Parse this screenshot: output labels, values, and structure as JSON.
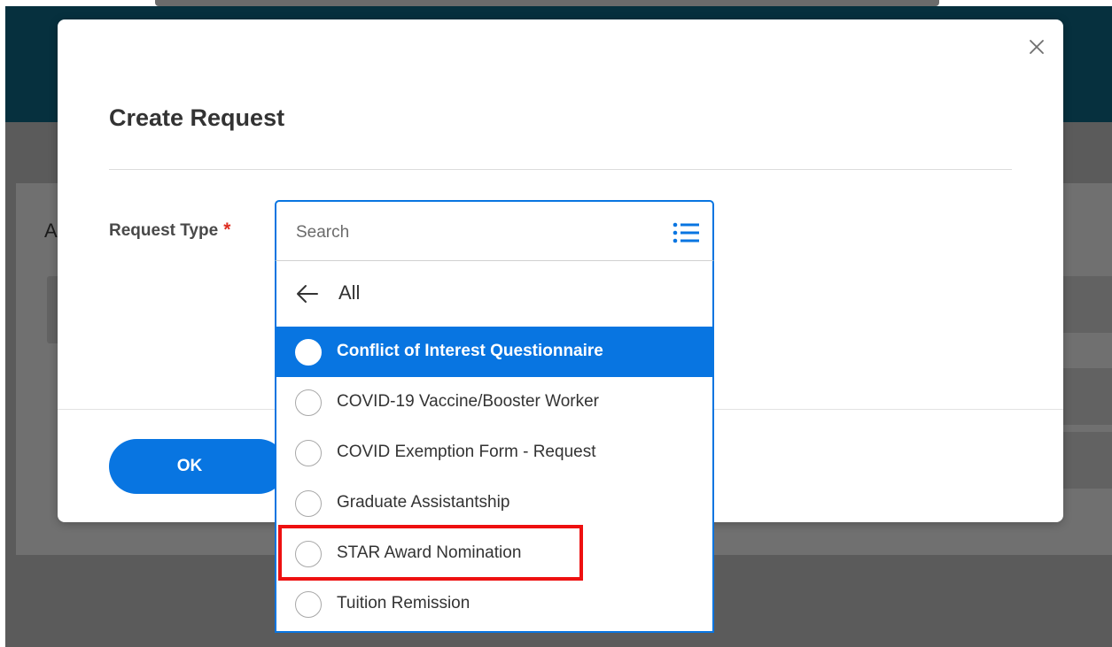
{
  "modal": {
    "title": "Create Request",
    "close_label": "×",
    "field_label": "Request Type",
    "required_mark": "*",
    "ok_label": "OK"
  },
  "background": {
    "card_letter": "A"
  },
  "search": {
    "placeholder": "Search",
    "icon": "list-icon"
  },
  "dropdown": {
    "back_label": "All",
    "back_icon": "arrow-left-icon",
    "options": [
      {
        "label": "Conflict of Interest Questionnaire",
        "selected": true
      },
      {
        "label": "COVID-19 Vaccine/Booster Worker",
        "selected": false
      },
      {
        "label": "COVID Exemption Form - Request",
        "selected": false
      },
      {
        "label": "Graduate Assistantship",
        "selected": false
      },
      {
        "label": "STAR Award Nomination",
        "selected": false
      },
      {
        "label": "Tuition Remission",
        "selected": false
      }
    ]
  },
  "colors": {
    "accent": "#0875e1",
    "header": "#06303e",
    "required": "#de2e21",
    "annotation": "#ee1010"
  }
}
